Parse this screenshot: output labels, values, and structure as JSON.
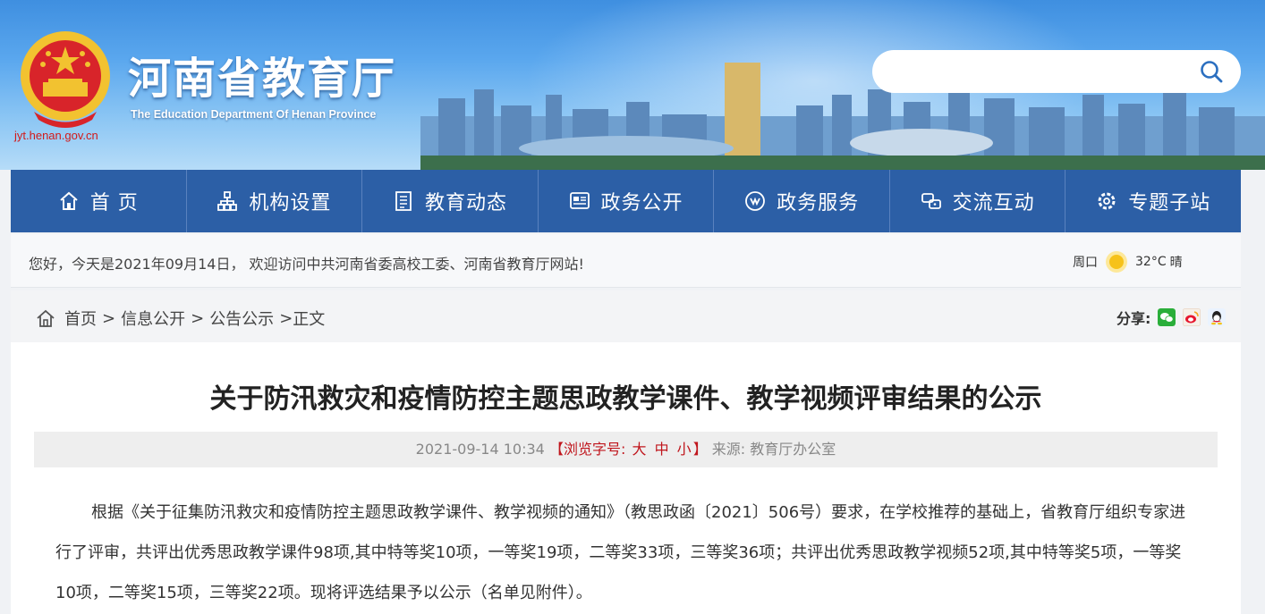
{
  "header": {
    "title": "河南省教育厅",
    "subtitle": "The Education Department Of Henan Province",
    "domain": "jyt.henan.gov.cn",
    "search": {
      "placeholder": "",
      "icon": "search-icon"
    }
  },
  "nav": {
    "items": [
      {
        "label": "首 页",
        "icon": "home-icon"
      },
      {
        "label": "机构设置",
        "icon": "org-chart-icon"
      },
      {
        "label": "教育动态",
        "icon": "news-list-icon"
      },
      {
        "label": "政务公开",
        "icon": "bulletin-board-icon"
      },
      {
        "label": "政务服务",
        "icon": "service-icon"
      },
      {
        "label": "交流互动",
        "icon": "interaction-icon"
      },
      {
        "label": "专题子站",
        "icon": "topic-gear-icon"
      }
    ]
  },
  "greeting": {
    "text": "您好，今天是2021年09月14日，  欢迎访问中共河南省委高校工委、河南省教育厅网站!",
    "weather": {
      "city": "周口",
      "temp": "32°C",
      "condition": "晴",
      "icon": "sun-icon"
    }
  },
  "breadcrumb": {
    "items": [
      "首页",
      "信息公开",
      "公告公示",
      "正文"
    ],
    "separator": ">"
  },
  "share": {
    "label": "分享:",
    "targets": [
      "wechat-icon",
      "weibo-icon",
      "qq-icon"
    ]
  },
  "article": {
    "title": "关于防汛救灾和疫情防控主题思政教学课件、教学视频评审结果的公示",
    "date": "2021-09-14 10:34",
    "font_size_label": "【浏览字号:",
    "font_sizes": [
      "大",
      "中",
      "小"
    ],
    "font_size_close": "】",
    "source_label": "来源:",
    "source": "教育厅办公室",
    "body": "根据《关于征集防汛救灾和疫情防控主题思政教学课件、教学视频的通知》（教思政函〔2021〕506号）要求，在学校推荐的基础上，省教育厅组织专家进行了评审，共评出优秀思政教学课件98项,其中特等奖10项，一等奖19项，二等奖33项，三等奖36项；共评出优秀思政教学视频52项,其中特等奖5项，一等奖10项，二等奖15项，三等奖22项。现将评选结果予以公示（名单见附件）。"
  },
  "colors": {
    "nav_bg": "#2c5fa6",
    "accent_red": "#c0161d",
    "title_text": "#222222"
  }
}
